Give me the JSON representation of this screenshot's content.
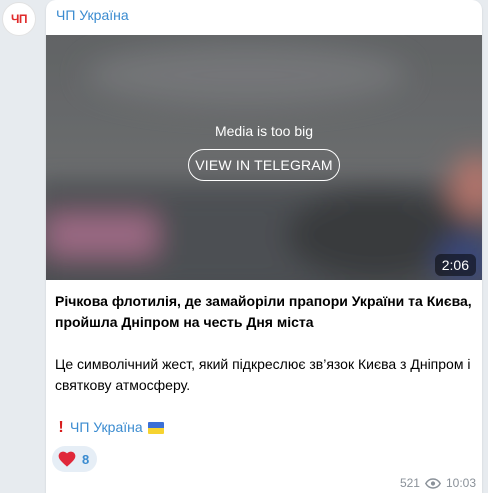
{
  "channel": {
    "avatar_text": "ЧП",
    "name": "ЧП Україна"
  },
  "media": {
    "notice": "Media is too big",
    "button_label": "VIEW IN TELEGRAM",
    "duration": "2:06"
  },
  "post": {
    "headline": "Річкова флотилія, де замайоріли прапори України та Києва, пройшла Дніпром на честь Дня міста",
    "body": "Це символічний жест, який підкреслює зв’язок Києва з Дніпром і святкову атмосферу.",
    "signature_link": "ЧП Україна"
  },
  "reactions": [
    {
      "icon": "heart-icon",
      "emoji": "❤️",
      "count": "8"
    }
  ],
  "footer": {
    "views": "521",
    "time": "10:03"
  },
  "colors": {
    "link": "#3a8bd0",
    "background": "#e7ebef",
    "bubble": "#ffffff",
    "avatar_text": "#e02a2a",
    "flag_top": "#3b6fd6",
    "flag_bottom": "#f6d330"
  }
}
